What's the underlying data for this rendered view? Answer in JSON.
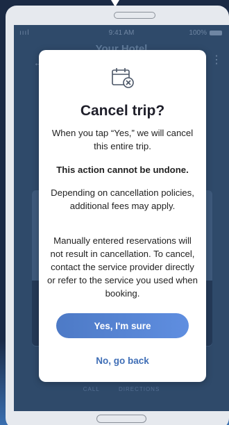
{
  "status_bar": {
    "signal": "ıııl",
    "time": "9:41 AM",
    "battery": "100%"
  },
  "app_bar": {
    "title": "Your Hotel"
  },
  "background": {
    "tabs": [
      "CALL",
      "DIRECTIONS"
    ]
  },
  "dialog": {
    "title": "Cancel trip?",
    "paragraph_1": "When you tap “Yes,” we will cancel this entire trip.",
    "warning": "This action cannot be undone.",
    "paragraph_2": "Depending on cancellation policies, additional fees may apply.",
    "paragraph_3": "Manually entered reservations will not result in cancellation. To cancel, contact the service provider directly or refer to the service you used when booking.",
    "confirm_label": "Yes, I'm sure",
    "cancel_label": "No, go back",
    "colors": {
      "primary": "#5f8ee0",
      "link": "#3f6eb6"
    },
    "icon": "calendar-cancel-icon"
  }
}
